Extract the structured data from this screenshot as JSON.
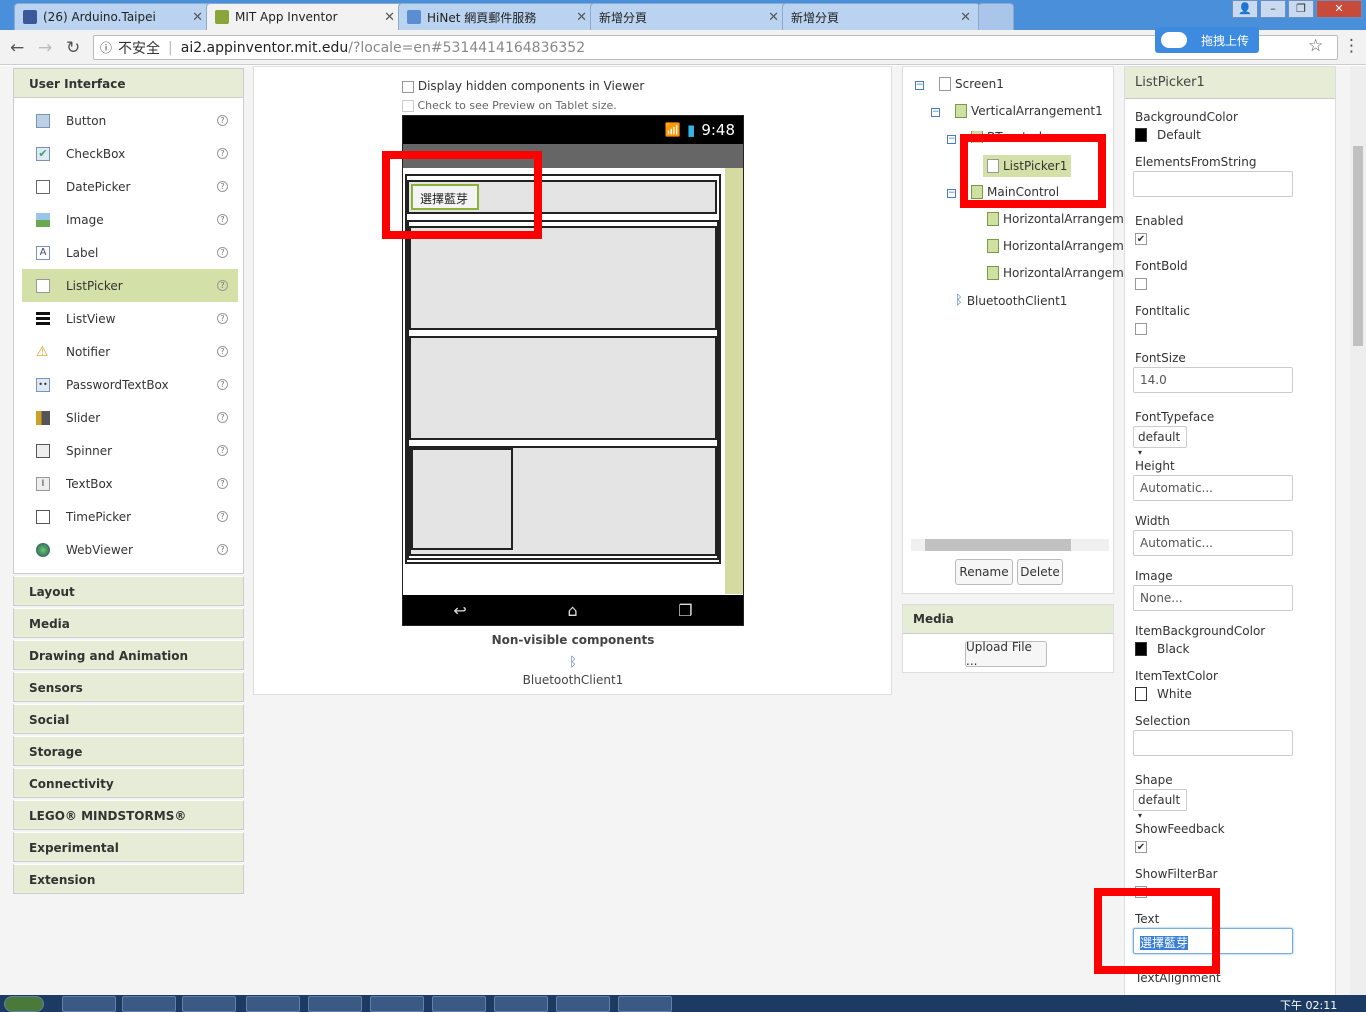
{
  "browser": {
    "tabs": [
      {
        "title": "(26) Arduino.Taipei",
        "color": "#3b5998"
      },
      {
        "title": "MIT App Inventor",
        "color": "#8aa63a"
      },
      {
        "title": "HiNet 網頁郵件服務",
        "color": "#5b8ed0"
      },
      {
        "title": "新增分頁",
        "color": "#cccccc"
      },
      {
        "title": "新增分頁",
        "color": "#cccccc"
      }
    ],
    "address": {
      "insecure": "不安全",
      "host": "ai2.appinventor.mit.edu",
      "rest": "/?locale=en#5314414164836352"
    },
    "upload_label": "拖拽上传"
  },
  "palette": {
    "header": "User Interface",
    "items": [
      {
        "label": "Button",
        "icon": "button-icon"
      },
      {
        "label": "CheckBox",
        "icon": "checkbox-icon"
      },
      {
        "label": "DatePicker",
        "icon": "datepicker-icon"
      },
      {
        "label": "Image",
        "icon": "image-icon"
      },
      {
        "label": "Label",
        "icon": "label-icon"
      },
      {
        "label": "ListPicker",
        "icon": "listpicker-icon"
      },
      {
        "label": "ListView",
        "icon": "listview-icon"
      },
      {
        "label": "Notifier",
        "icon": "notifier-icon"
      },
      {
        "label": "PasswordTextBox",
        "icon": "password-icon"
      },
      {
        "label": "Slider",
        "icon": "slider-icon"
      },
      {
        "label": "Spinner",
        "icon": "spinner-icon"
      },
      {
        "label": "TextBox",
        "icon": "textbox-icon"
      },
      {
        "label": "TimePicker",
        "icon": "timepicker-icon"
      },
      {
        "label": "WebViewer",
        "icon": "webviewer-icon"
      }
    ],
    "help": "?",
    "categories": [
      "Layout",
      "Media",
      "Drawing and Animation",
      "Sensors",
      "Social",
      "Storage",
      "Connectivity",
      "LEGO® MINDSTORMS®",
      "Experimental",
      "Extension"
    ]
  },
  "viewer": {
    "hidden_label": "Display hidden components in Viewer",
    "tablet_label": "Check to see Preview on Tablet size.",
    "time": "9:48",
    "listpicker_text": "選擇藍芽",
    "nonvisible_header": "Non-visible components",
    "nonvisible_item": "BluetoothClient1"
  },
  "tree": {
    "screen": "Screen1",
    "va": "VerticalArrangement1",
    "bt": "BTcontrol",
    "lp": "ListPicker1",
    "main": "MainControl",
    "ha": [
      "HorizontalArrangem",
      "HorizontalArrangem",
      "HorizontalArrangem"
    ],
    "btc": "BluetoothClient1",
    "rename": "Rename",
    "delete": "Delete"
  },
  "media": {
    "header": "Media",
    "upload": "Upload File ..."
  },
  "props": {
    "header": "ListPicker1",
    "bg_label": "BackgroundColor",
    "bg_value": "Default",
    "efs_label": "ElementsFromString",
    "enabled_label": "Enabled",
    "bold_label": "FontBold",
    "italic_label": "FontItalic",
    "size_label": "FontSize",
    "size_value": "14.0",
    "face_label": "FontTypeface",
    "face_value": "default",
    "height_label": "Height",
    "height_value": "Automatic...",
    "width_label": "Width",
    "width_value": "Automatic...",
    "image_label": "Image",
    "image_value": "None...",
    "ibg_label": "ItemBackgroundColor",
    "ibg_value": "Black",
    "itc_label": "ItemTextColor",
    "itc_value": "White",
    "sel_label": "Selection",
    "shape_label": "Shape",
    "shape_value": "default",
    "feedback_label": "ShowFeedback",
    "filter_label": "ShowFilterBar",
    "text_label": "Text",
    "text_value": "選擇藍芽",
    "align_label": "TextAlignment"
  },
  "taskbar": {
    "clock": "下午 02:11"
  },
  "colors": {
    "highlight": "#ff0000",
    "accent": "#d3e0a8",
    "header": "#e6ecd5"
  }
}
